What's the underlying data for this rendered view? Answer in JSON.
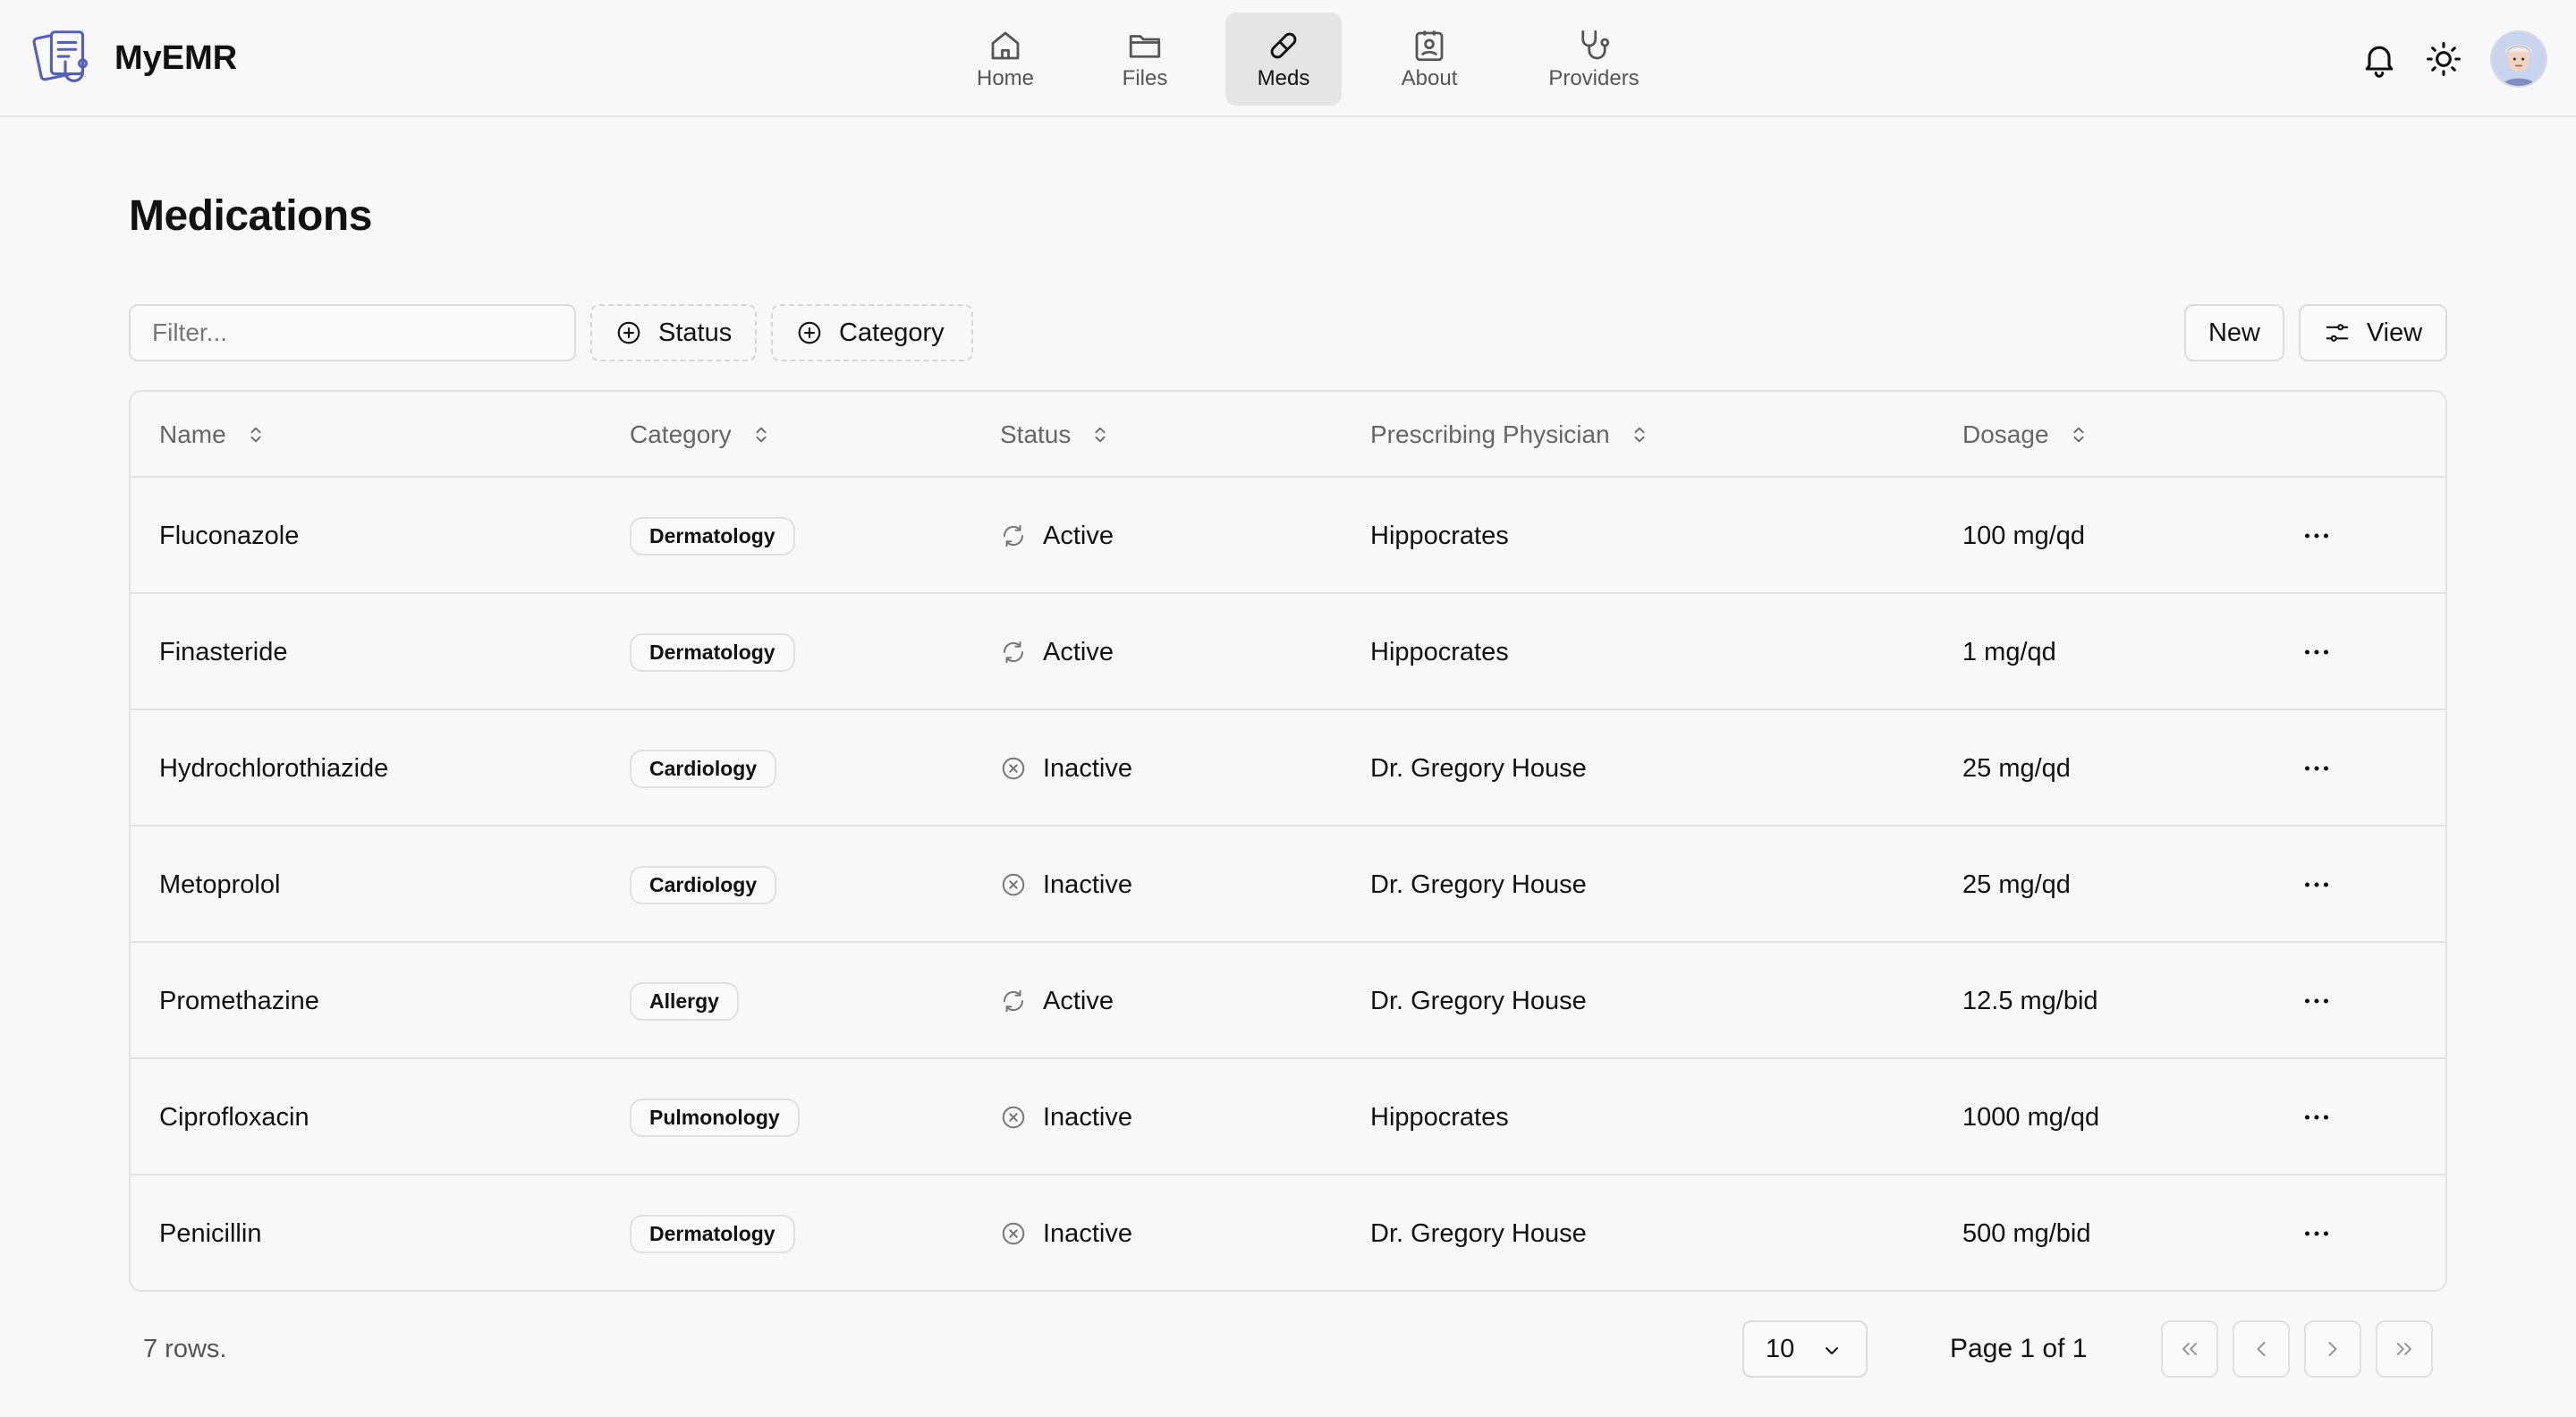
{
  "app": {
    "name": "MyEMR"
  },
  "nav": [
    {
      "label": "Home",
      "icon": "home-icon"
    },
    {
      "label": "Files",
      "icon": "folder-icon"
    },
    {
      "label": "Meds",
      "icon": "pill-icon",
      "active": true
    },
    {
      "label": "About",
      "icon": "id-badge-icon"
    },
    {
      "label": "Providers",
      "icon": "stethoscope-icon"
    }
  ],
  "header_icons": [
    "bell-icon",
    "sun-icon",
    "avatar"
  ],
  "page": {
    "title": "Medications"
  },
  "toolbar": {
    "filter_placeholder": "Filter...",
    "status_label": "Status",
    "category_label": "Category",
    "new_label": "New",
    "view_label": "View"
  },
  "table": {
    "columns": [
      "Name",
      "Category",
      "Status",
      "Prescribing Physician",
      "Dosage"
    ],
    "rows": [
      {
        "name": "Fluconazole",
        "category": "Dermatology",
        "status": "Active",
        "physician": "Hippocrates",
        "dosage": "100 mg/qd"
      },
      {
        "name": "Finasteride",
        "category": "Dermatology",
        "status": "Active",
        "physician": "Hippocrates",
        "dosage": "1 mg/qd"
      },
      {
        "name": "Hydrochlorothiazide",
        "category": "Cardiology",
        "status": "Inactive",
        "physician": "Dr. Gregory House",
        "dosage": "25 mg/qd"
      },
      {
        "name": "Metoprolol",
        "category": "Cardiology",
        "status": "Inactive",
        "physician": "Dr. Gregory House",
        "dosage": "25 mg/qd"
      },
      {
        "name": "Promethazine",
        "category": "Allergy",
        "status": "Active",
        "physician": "Dr. Gregory House",
        "dosage": "12.5 mg/bid"
      },
      {
        "name": "Ciprofloxacin",
        "category": "Pulmonology",
        "status": "Inactive",
        "physician": "Hippocrates",
        "dosage": "1000 mg/qd"
      },
      {
        "name": "Penicillin",
        "category": "Dermatology",
        "status": "Inactive",
        "physician": "Dr. Gregory House",
        "dosage": "500 mg/bid"
      }
    ]
  },
  "footer": {
    "rows_count": "7 rows.",
    "page_size": "10",
    "page_label": "Page 1 of 1"
  }
}
